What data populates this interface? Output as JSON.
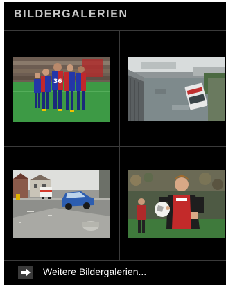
{
  "header": {
    "title": "BILDERGALERIEN"
  },
  "galleries": [
    {
      "icon": "football-team-celebration-photo"
    },
    {
      "icon": "flood-river-bus-photo"
    },
    {
      "icon": "car-accident-street-photo"
    },
    {
      "icon": "football-player-portrait-photo"
    }
  ],
  "footer": {
    "label": "Weitere Bildergalerien...",
    "icon": "arrow-right-icon"
  },
  "colors": {
    "background": "#000000",
    "divider": "#3a3a3a",
    "header_text": "#c9c9c9",
    "footer_text": "#ffffff",
    "arrow_box": "#3a3a3a"
  }
}
